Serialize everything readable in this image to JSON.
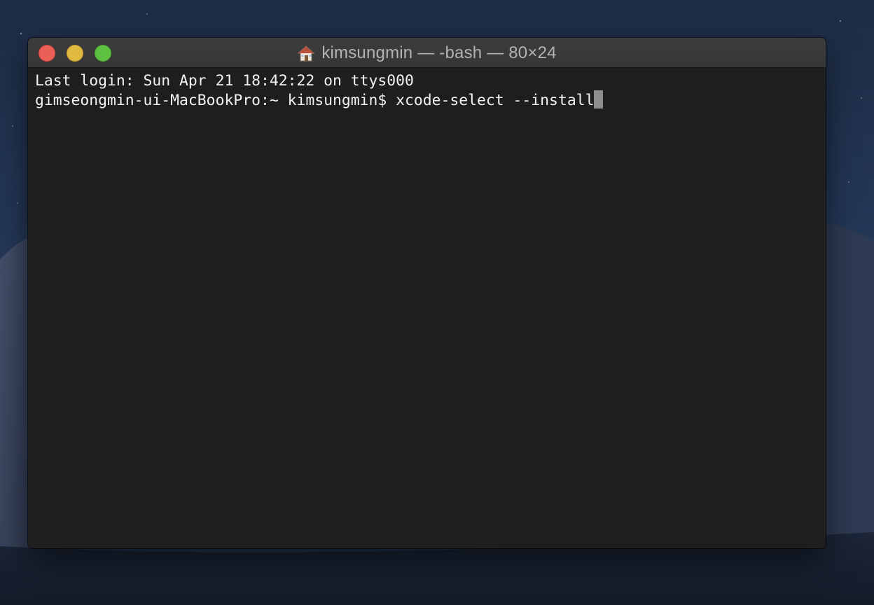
{
  "window": {
    "title": "kimsungmin — -bash — 80×24",
    "title_icon": "home-folder-icon"
  },
  "traffic_lights": {
    "close_color": "#ec5f56",
    "minimize_color": "#e0b940",
    "zoom_color": "#5fc142"
  },
  "terminal": {
    "lines": [
      "Last login: Sun Apr 21 18:42:22 on ttys000",
      "gimseongmin-ui-MacBookPro:~ kimsungmin$ xcode-select --install"
    ],
    "background": "#1e1e1e",
    "text_color": "#f2f2f2",
    "cursor_color": "#8e8e8e"
  }
}
